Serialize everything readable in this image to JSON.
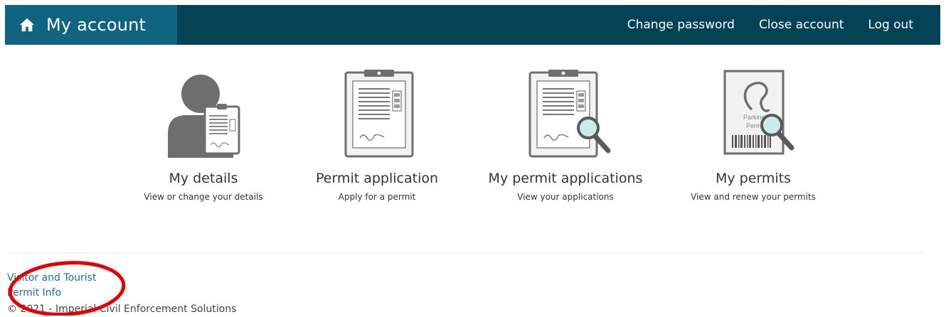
{
  "header": {
    "title": "My account",
    "home_icon": "home-icon",
    "links": [
      "Change password",
      "Close account",
      "Log out"
    ]
  },
  "tiles": [
    {
      "title": "My details",
      "subtitle": "View or change your details",
      "icon": "user-details-icon"
    },
    {
      "title": "Permit application",
      "subtitle": "Apply for a permit",
      "icon": "clipboard-icon"
    },
    {
      "title": "My permit applications",
      "subtitle": "View your applications",
      "icon": "clipboard-search-icon"
    },
    {
      "title": "My permits",
      "subtitle": "View and renew your permits",
      "icon": "parking-permit-icon"
    }
  ],
  "icon_text": {
    "parking": "Parking",
    "permit": "Permit"
  },
  "footer": {
    "link_line1": "Visitor and Tourist",
    "link_line2": "Permit Info",
    "copyright": "© 2021 - Imperial Civil Enforcement Solutions"
  },
  "colors": {
    "navbar": "#044356",
    "brand": "#0f6482",
    "link": "#1c6f99",
    "annotation": "#e60000"
  }
}
